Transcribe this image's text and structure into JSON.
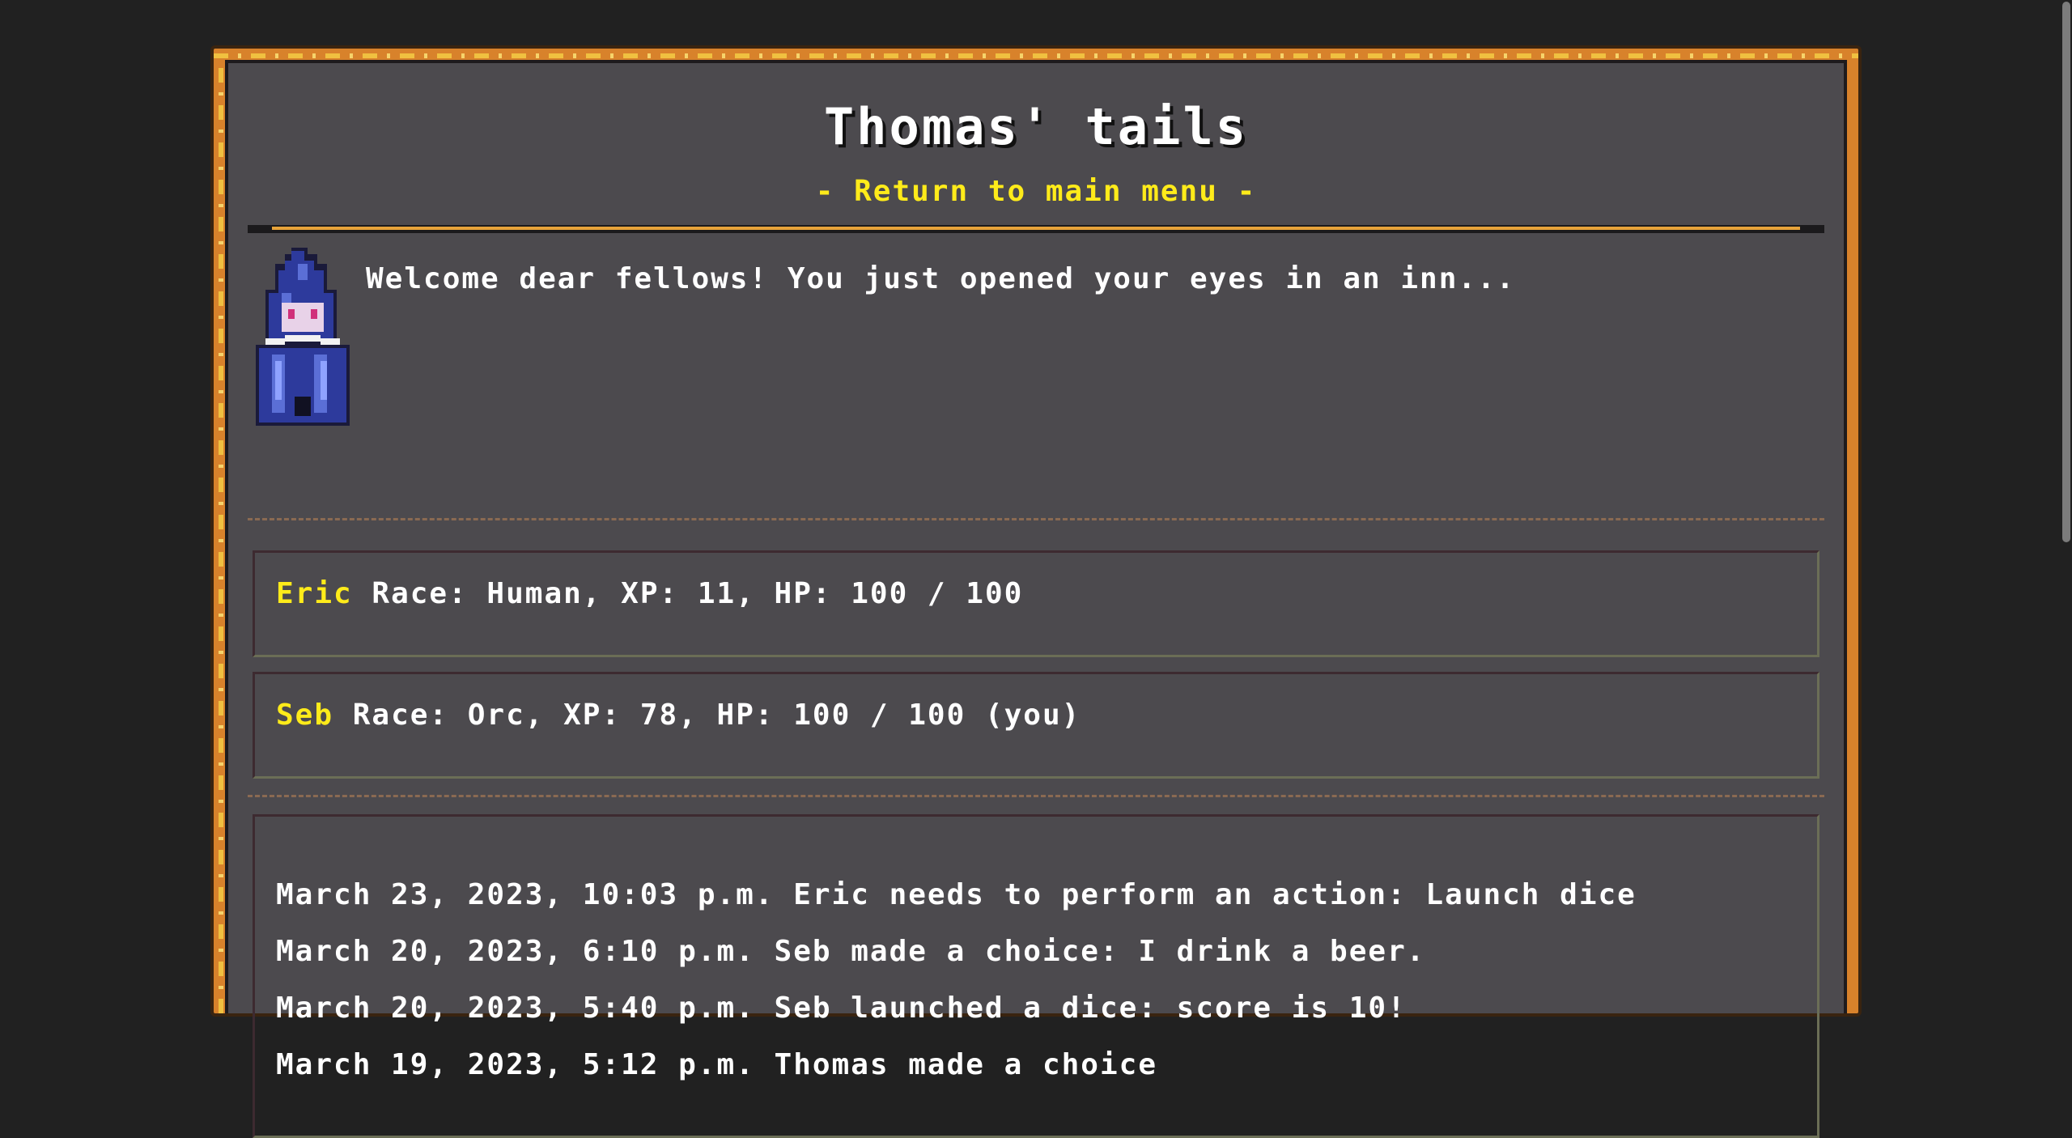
{
  "header": {
    "title": "Thomas' tails",
    "return_link": "- Return to main menu -"
  },
  "narrator": {
    "icon": "blue-hooded-ghost-sprite",
    "message": "Welcome dear fellows! You just opened your eyes in an inn..."
  },
  "players": [
    {
      "name": "Eric",
      "details": "Race: Human, XP: 11, HP: 100 / 100"
    },
    {
      "name": "Seb",
      "details": "Race: Orc, XP: 78, HP: 100 / 100 (you)"
    }
  ],
  "log": [
    "March 23, 2023, 10:03 p.m. Eric needs to perform an action: Launch dice",
    "March 20, 2023, 6:10 p.m. Seb made a choice: I drink a beer.",
    "March 20, 2023, 5:40 p.m. Seb launched a dice: score is 10!",
    "March 19, 2023, 5:12 p.m. Thomas made a choice"
  ],
  "colors": {
    "background": "#212121",
    "panel": "#4c4a4e",
    "frame": "#d8822b",
    "accent": "#ffeb1a",
    "text": "#ffffff"
  }
}
